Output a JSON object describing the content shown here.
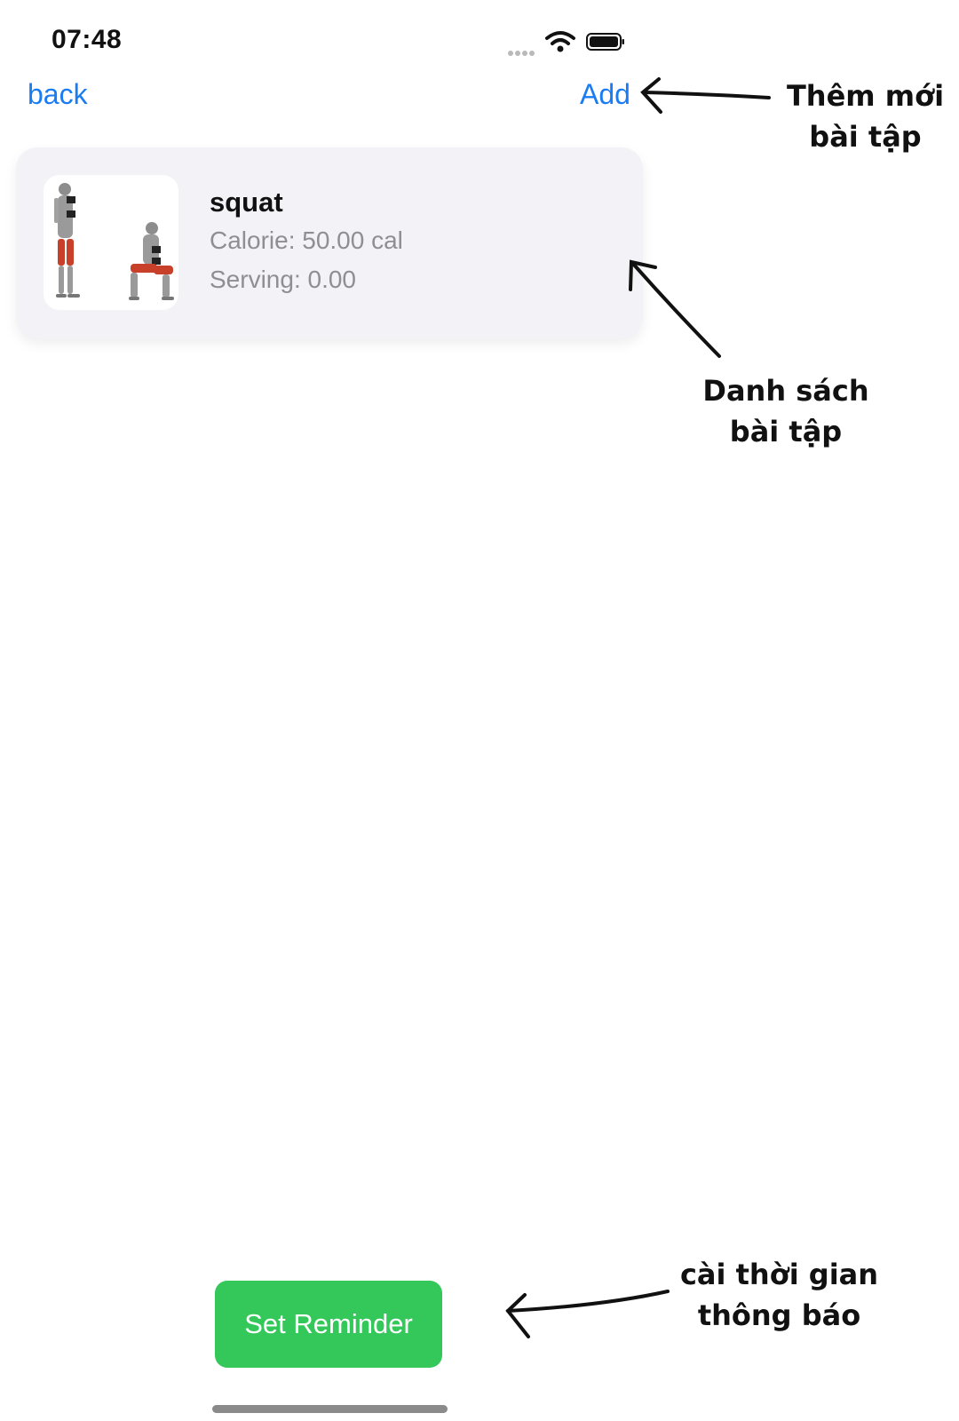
{
  "status_bar": {
    "time": "07:48"
  },
  "nav": {
    "back_label": "back",
    "add_label": "Add"
  },
  "exercises": [
    {
      "name": "squat",
      "calorie": "Calorie: 50.00 cal",
      "serving": "Serving: 0.00"
    }
  ],
  "actions": {
    "set_reminder_label": "Set Reminder"
  },
  "annotations": {
    "add_line1": "Thêm mới",
    "add_line2": "bài tập",
    "list_line1": "Danh sách",
    "list_line2": "bài tập",
    "reminder_line1": "cài thời gian",
    "reminder_line2": "thông báo"
  },
  "colors": {
    "link": "#1a7cf3",
    "button": "#34c759",
    "card": "#f2f2f7"
  }
}
